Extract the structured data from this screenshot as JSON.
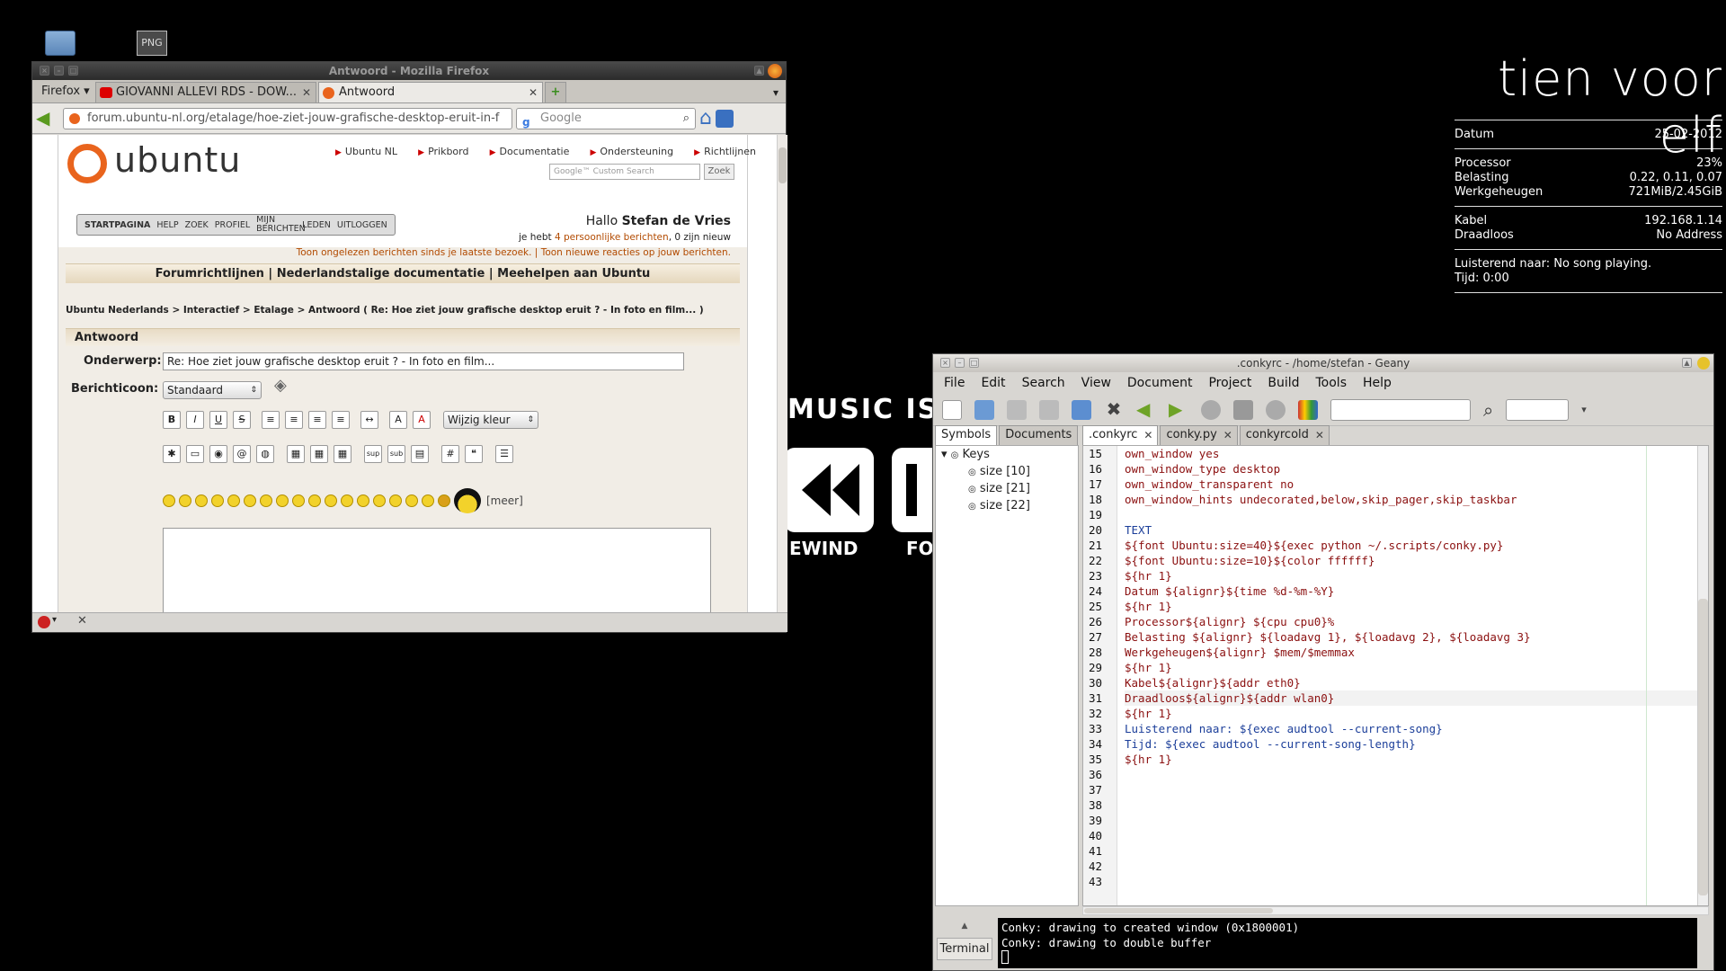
{
  "desktop": {
    "png_label": "PNG"
  },
  "conky": {
    "clock": "tien voor elf",
    "rows1": [
      {
        "label": "Datum",
        "value": "25-02-2012"
      }
    ],
    "rows2": [
      {
        "label": "Processor",
        "value": "23%"
      },
      {
        "label": "Belasting",
        "value": "0.22, 0.11, 0.07"
      },
      {
        "label": "Werkgeheugen",
        "value": "721MiB/2.45GiB"
      }
    ],
    "rows3": [
      {
        "label": "Kabel",
        "value": "192.168.1.14"
      },
      {
        "label": "Draadloos",
        "value": "No Address"
      }
    ],
    "song": "Luisterend naar: No song playing.",
    "time": "Tijd: 0:00"
  },
  "music": {
    "banner": "MUSIC IS L",
    "rewind": "EWIND",
    "forward": "FO"
  },
  "firefox": {
    "title": "Antwoord - Mozilla Firefox",
    "menu_label": "Firefox",
    "tabs": [
      {
        "label": "GIOVANNI ALLEVI RDS - DOW..."
      },
      {
        "label": "Antwoord"
      }
    ],
    "url": "forum.ubuntu-nl.org/etalage/hoe-ziet-jouw-grafische-desktop-eruit-in-f",
    "search_placeholder": "Google",
    "page": {
      "logo": "ubuntu",
      "topnav": [
        "Ubuntu NL",
        "Prikbord",
        "Documentatie",
        "Ondersteuning",
        "Richtlijnen"
      ],
      "search_placeholder": "Google™ Custom Search",
      "search_button": "Zoek",
      "menu": [
        "STARTPAGINA",
        "HELP",
        "ZOEK",
        "PROFIEL",
        "MIJN BERICHTEN",
        "LEDEN",
        "UITLOGGEN"
      ],
      "greeting": "Hallo",
      "username": "Stefan de Vries",
      "messages_prefix": "je hebt",
      "messages_link": "4 persoonlijke berichten",
      "messages_suffix": ", 0 zijn nieuw",
      "unread_link": "Toon ongelezen berichten sinds je laatste bezoek.",
      "replies_link": "Toon nieuwe reacties op jouw berichten.",
      "banner_links": [
        "Forumrichtlijnen",
        "Nederlandstalige documentatie",
        "Meehelpen aan Ubuntu"
      ],
      "breadcrumb": "Ubuntu Nederlands > Interactief > Etalage > Antwoord ( Re: Hoe ziet jouw grafische desktop eruit ? - In foto en film... )",
      "section_title": "Antwoord",
      "subject_label": "Onderwerp:",
      "subject_value": "Re: Hoe ziet jouw grafische desktop eruit ? - In foto en film...",
      "icon_label": "Berichticoon:",
      "icon_select": "Standaard",
      "color_select": "Wijzig kleur",
      "format_buttons": [
        "B",
        "I",
        "U",
        "S"
      ],
      "more_smileys": "[meer]"
    }
  },
  "geany": {
    "title": ".conkyrc - /home/stefan - Geany",
    "menu": [
      "File",
      "Edit",
      "Search",
      "View",
      "Document",
      "Project",
      "Build",
      "Tools",
      "Help"
    ],
    "side_tabs": [
      "Symbols",
      "Documents"
    ],
    "tree_root": "Keys",
    "tree_items": [
      "size [10]",
      "size [21]",
      "size [22]"
    ],
    "file_tabs": [
      ".conkyrc",
      "conky.py",
      "conkyrcold"
    ],
    "line_numbers": [
      "15",
      "16",
      "17",
      "18",
      "19",
      "20",
      "21",
      "22",
      "23",
      "24",
      "25",
      "26",
      "27",
      "28",
      "29",
      "30",
      "31",
      "32",
      "33",
      "34",
      "35",
      "36",
      "37",
      "38",
      "39",
      "40",
      "41",
      "42",
      "43"
    ],
    "code_lines": [
      "own_window yes",
      "own_window_type desktop",
      "own_window_transparent no",
      "own_window_hints undecorated,below,skip_pager,skip_taskbar",
      "",
      "TEXT",
      "${font Ubuntu:size=40}${exec python ~/.scripts/conky.py}",
      "${font Ubuntu:size=10}${color ffffff}",
      "${hr 1}",
      "Datum ${alignr}${time %d-%m-%Y}",
      "${hr 1}",
      "Processor${alignr} ${cpu cpu0}%",
      "Belasting ${alignr} ${loadavg 1}, ${loadavg 2}, ${loadavg 3}",
      "Werkgeheugen${alignr} $mem/$memmax",
      "${hr 1}",
      "Kabel${alignr}${addr eth0}",
      "Draadloos${alignr}${addr wlan0}",
      "${hr 1}",
      "Luisterend naar: ${exec audtool --current-song}",
      "Tijd: ${exec audtool --current-song-length}",
      "${hr 1}",
      "",
      "",
      "",
      "",
      "",
      "",
      "",
      ""
    ],
    "terminal_tab": "Terminal",
    "terminal_lines": [
      "Conky: drawing to created window (0x1800001)",
      "Conky: drawing to double buffer"
    ]
  }
}
